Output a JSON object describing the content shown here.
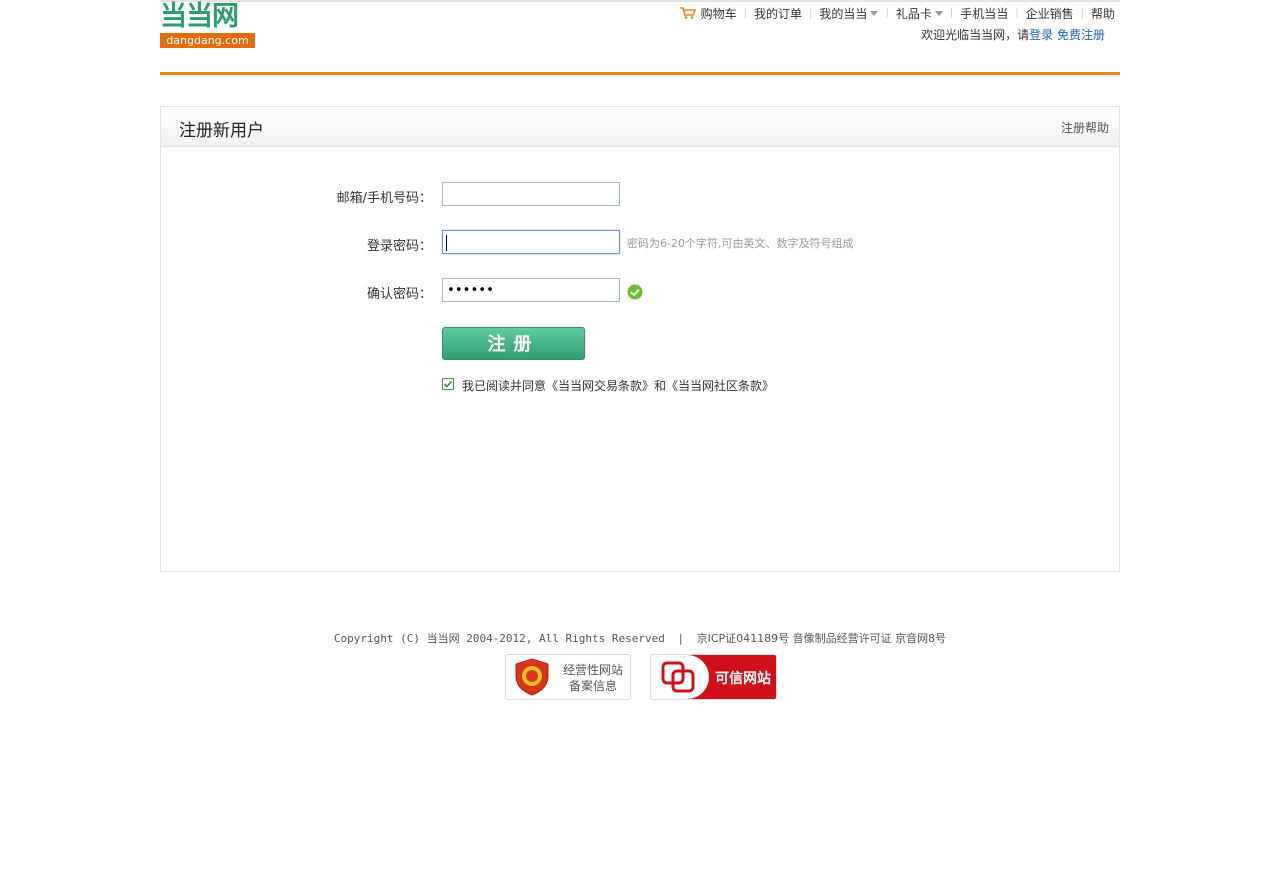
{
  "logo": {
    "cn": "当当网",
    "en": "dangdang.com"
  },
  "topnav": {
    "cart": "购物车",
    "orders": "我的订单",
    "my": "我的当当",
    "gift": "礼品卡",
    "mobile": "手机当当",
    "enterprise": "企业销售",
    "help": "帮助"
  },
  "welcome": {
    "text": "欢迎光临当当网，请",
    "login": "登录",
    "register": "免费注册"
  },
  "panel": {
    "title": "注册新用户",
    "help": "注册帮助"
  },
  "form": {
    "email_label": "邮箱/手机号码：",
    "email_value": "",
    "password_label": "登录密码：",
    "password_value": "",
    "password_hint": "密码为6-20个字符,可由英文、数字及符号组成",
    "confirm_label": "确认密码：",
    "confirm_value": "••••••",
    "submit_label": "注册",
    "agree_prefix": "我已阅读并同意",
    "agree_terms1": "《当当网交易条款》",
    "agree_and": "和",
    "agree_terms2": "《当当网社区条款》",
    "agree_checked": true
  },
  "footer": {
    "copyright": "Copyright (C) 当当网 2004-2012, All Rights Reserved",
    "sep": "|",
    "icp": "京ICP证041189号 音像制品经营许可证 京音网8号",
    "badge1_line1": "经营性网站",
    "badge1_line2": "备案信息",
    "badge2": "可信网站"
  },
  "colors": {
    "brand_green": "#2b9e6f",
    "brand_orange": "#e8850e",
    "link_blue": "#1a66b3"
  },
  "icons": [
    "cart-icon",
    "dropdown-arrow-icon",
    "checkmark-icon",
    "checkbox-checked-icon",
    "shield-badge-icon",
    "trusted-site-icon"
  ]
}
